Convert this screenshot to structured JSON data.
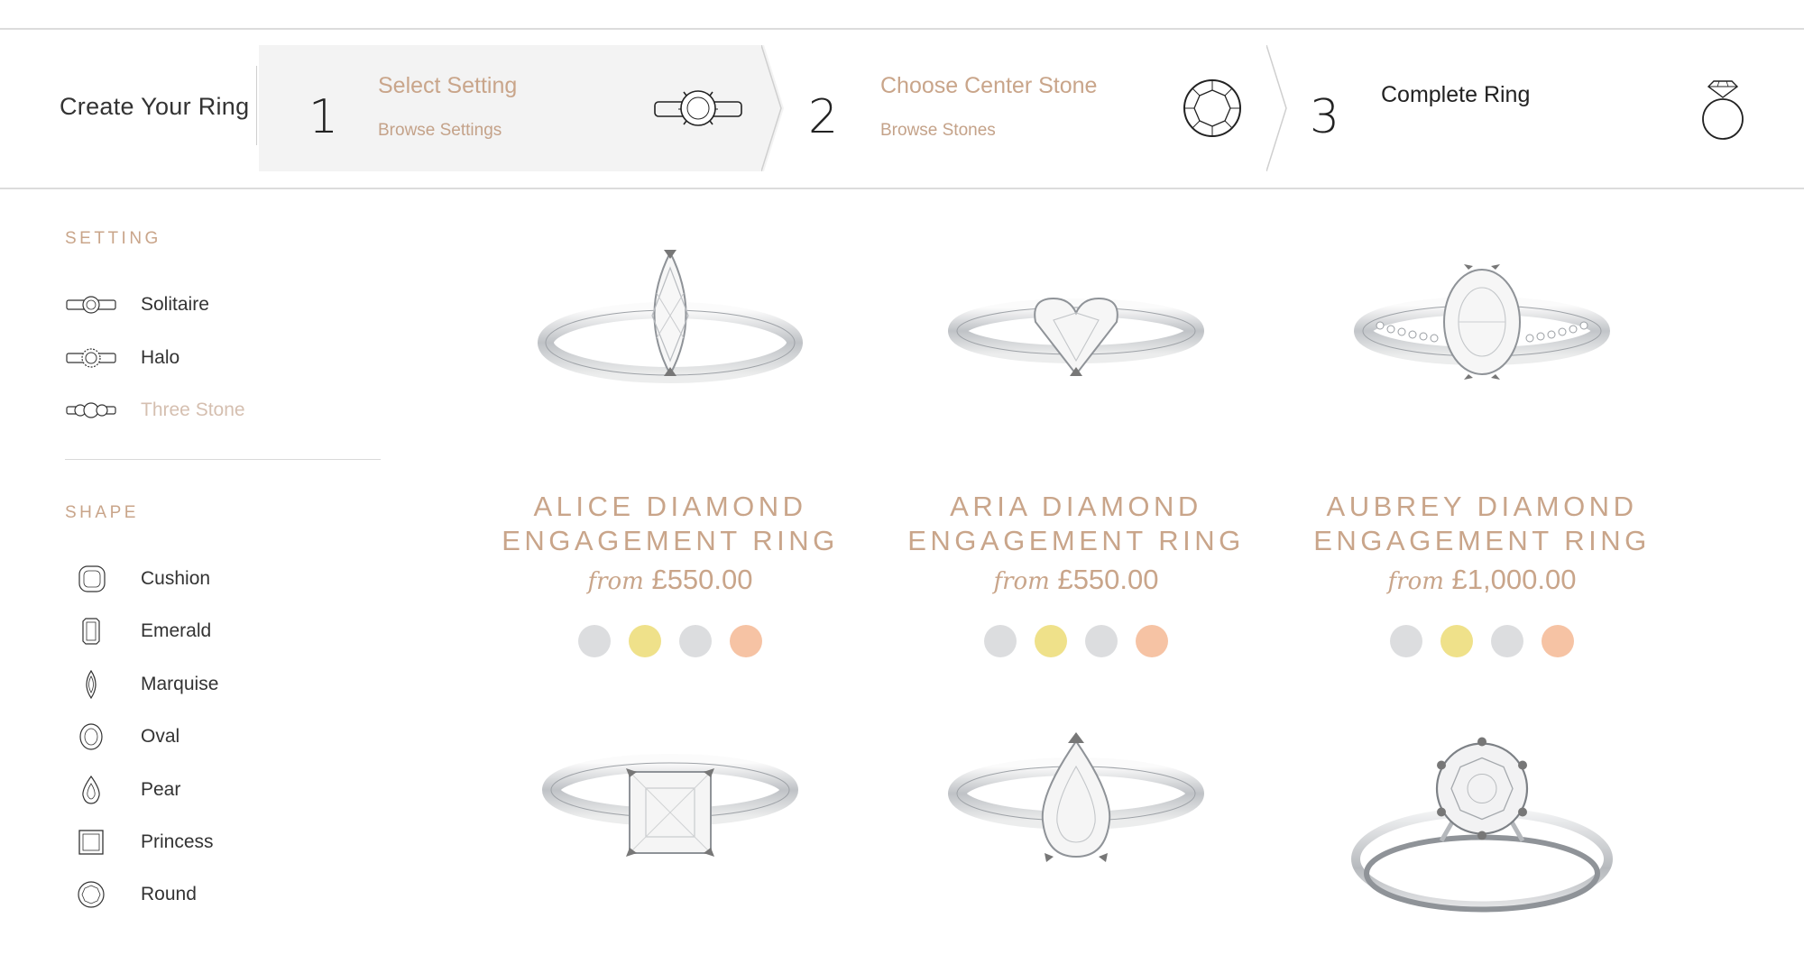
{
  "builder": {
    "title": "Create Your Ring",
    "steps": [
      {
        "number": "1",
        "title": "Select Setting",
        "subtitle": "Browse Settings",
        "icon": "ring-setting-icon",
        "state": "active"
      },
      {
        "number": "2",
        "title": "Choose Center Stone",
        "subtitle": "Browse Stones",
        "icon": "round-diamond-icon",
        "state": "upcoming"
      },
      {
        "number": "3",
        "title": "Complete Ring",
        "subtitle": "",
        "icon": "finished-ring-icon",
        "state": "upcoming"
      }
    ]
  },
  "sidebar": {
    "setting_heading": "SETTING",
    "settings": [
      {
        "label": "Solitaire",
        "icon": "solitaire-icon",
        "selected": false
      },
      {
        "label": "Halo",
        "icon": "halo-icon",
        "selected": false
      },
      {
        "label": "Three Stone",
        "icon": "three-stone-icon",
        "selected": true
      }
    ],
    "shape_heading": "SHAPE",
    "shapes": [
      {
        "label": "Cushion",
        "icon": "cushion-icon"
      },
      {
        "label": "Emerald",
        "icon": "emerald-icon"
      },
      {
        "label": "Marquise",
        "icon": "marquise-icon"
      },
      {
        "label": "Oval",
        "icon": "oval-icon"
      },
      {
        "label": "Pear",
        "icon": "pear-icon"
      },
      {
        "label": "Princess",
        "icon": "princess-icon"
      },
      {
        "label": "Round",
        "icon": "round-icon"
      }
    ]
  },
  "products": [
    {
      "name_line1": "ALICE DIAMOND",
      "name_line2": "ENGAGEMENT RING",
      "price_prefix": "from",
      "price": "£550.00",
      "stone": "marquise"
    },
    {
      "name_line1": "ARIA DIAMOND",
      "name_line2": "ENGAGEMENT RING",
      "price_prefix": "from",
      "price": "£550.00",
      "stone": "heart"
    },
    {
      "name_line1": "AUBREY DIAMOND",
      "name_line2": "ENGAGEMENT RING",
      "price_prefix": "from",
      "price": "£1,000.00",
      "stone": "oval-pave"
    },
    {
      "stone": "princess"
    },
    {
      "stone": "pear"
    },
    {
      "stone": "round-six-claw"
    }
  ],
  "metal_swatches": [
    {
      "name": "platinum",
      "color": "#dcdddf"
    },
    {
      "name": "yellow-gold",
      "color": "#efe18a"
    },
    {
      "name": "white-gold",
      "color": "#dcdddf"
    },
    {
      "name": "rose-gold",
      "color": "#f6c3a4"
    }
  ],
  "colors": {
    "accent": "#c9a58a",
    "text": "#333333",
    "active_step_bg": "#f3f3f3"
  }
}
